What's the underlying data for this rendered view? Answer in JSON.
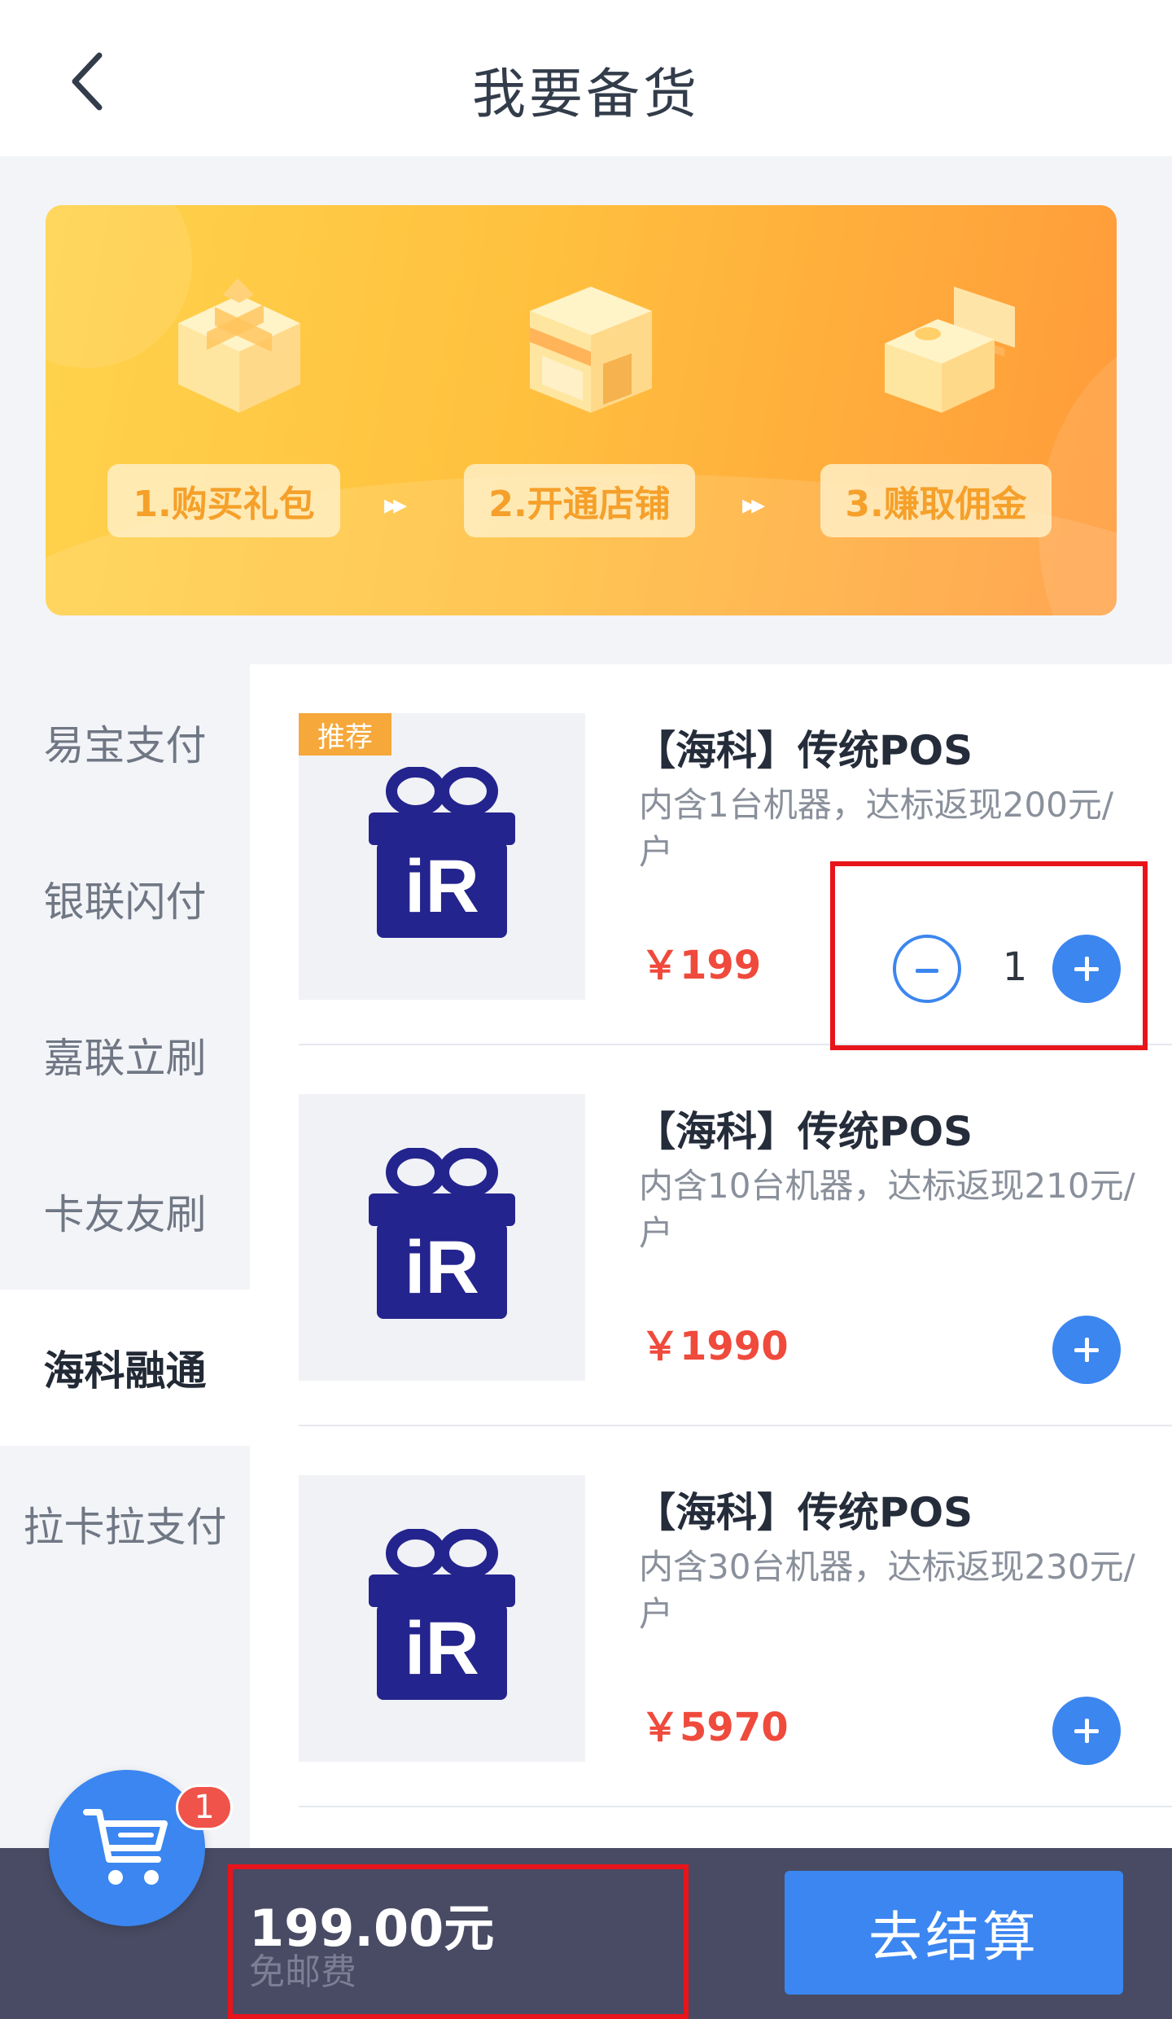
{
  "header": {
    "title": "我要备货",
    "back_icon": "chevron-left-icon"
  },
  "banner": {
    "steps": [
      {
        "label": "1.购买礼包",
        "icon": "gift-box-icon"
      },
      {
        "label": "2.开通店铺",
        "icon": "store-icon"
      },
      {
        "label": "3.赚取佣金",
        "icon": "money-box-icon"
      }
    ],
    "arrow": "▸▸"
  },
  "sidebar": {
    "items": [
      {
        "label": "易宝支付",
        "active": false
      },
      {
        "label": "银联闪付",
        "active": false
      },
      {
        "label": "嘉联立刷",
        "active": false
      },
      {
        "label": "卡友友刷",
        "active": false
      },
      {
        "label": "海科融通",
        "active": true
      },
      {
        "label": "拉卡拉支付",
        "active": false
      }
    ]
  },
  "products": [
    {
      "badge": "推荐",
      "name": "【海科】传统POS",
      "desc": "内含1台机器，达标返现200元/户",
      "price": "￥199",
      "qty": "1"
    },
    {
      "badge": "",
      "name": "【海科】传统POS",
      "desc": "内含10台机器，达标返现210元/户",
      "price": "￥1990",
      "qty": ""
    },
    {
      "badge": "",
      "name": "【海科】传统POS",
      "desc": "内含30台机器，达标返现230元/户",
      "price": "￥5970",
      "qty": ""
    }
  ],
  "product_logo_text": "iR",
  "bottom": {
    "total": "199.00元",
    "shipping": "免邮费",
    "checkout_label": "去结算",
    "cart_count": "1"
  },
  "colors": {
    "accent": "#3b86f0",
    "price": "#ef4a3c",
    "banner_start": "#ffd34c",
    "banner_end": "#ff9a3a",
    "highlight": "#e8141b"
  }
}
